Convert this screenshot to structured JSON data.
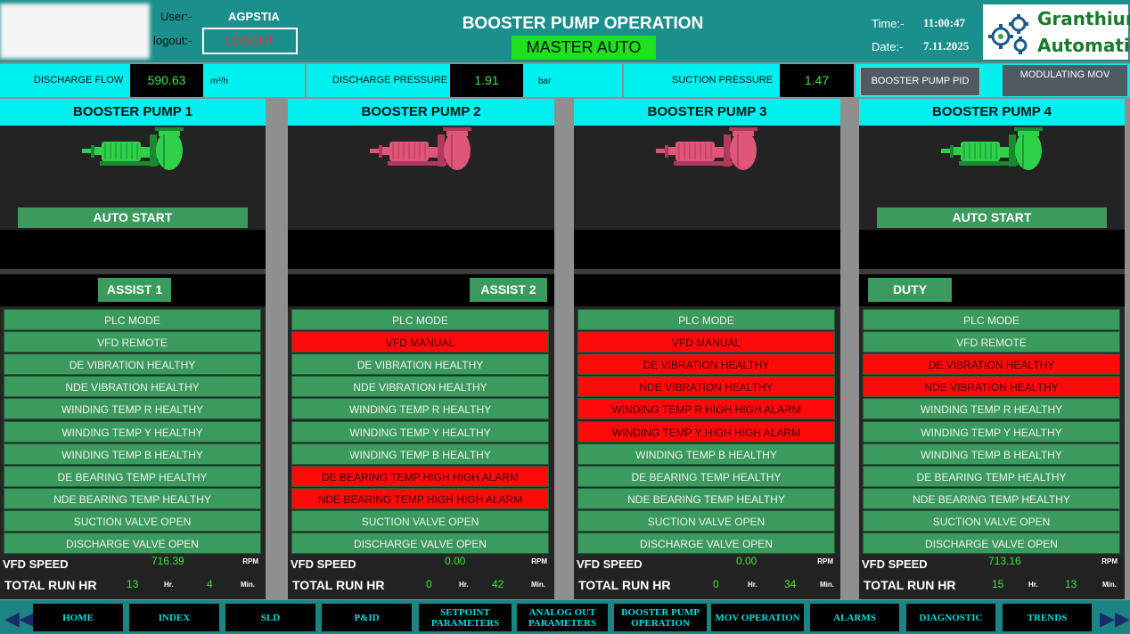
{
  "header": {
    "user_label": "User:-",
    "user_value": "AGPSTIA",
    "logout_label": "logout:-",
    "logout_button": "LOGOUT",
    "title": "BOOSTER PUMP OPERATION",
    "mode": "MASTER AUTO",
    "time_label": "Time:-",
    "time_value": "11:00:47",
    "date_label": "Date:-",
    "date_value": "7.11.2025",
    "logo_line1": "Granthium",
    "logo_line2": "Automation"
  },
  "measurements": {
    "discharge_flow_label": "DISCHARGE FLOW",
    "discharge_flow_value": "590.63",
    "discharge_flow_unit": "m³/h",
    "discharge_pressure_label": "DISCHARGE PRESSURE",
    "discharge_pressure_value": "1.91",
    "discharge_pressure_unit": "bar",
    "suction_pressure_label": "SUCTION PRESSURE",
    "suction_pressure_value": "1.47",
    "pid_button": "BOOSTER PUMP PID",
    "mov_button": "MODULATING MOV"
  },
  "labels": {
    "vfd_speed": "VFD SPEED",
    "rpm": "RPM",
    "total_run": "TOTAL RUN HR",
    "hr": "Hr.",
    "min": "Min."
  },
  "colors": {
    "ok": "#3b9a5e",
    "alarm": "#ff0a0a",
    "running": "#2fd14a",
    "stopped": "#e0557a"
  },
  "pumps": [
    {
      "title": "BOOSTER PUMP 1",
      "running": true,
      "auto_start": "AUTO START",
      "role": "ASSIST 1",
      "status": [
        {
          "text": "PLC MODE",
          "alarm": false
        },
        {
          "text": "VFD REMOTE",
          "alarm": false
        },
        {
          "text": "DE VIBRATION HEALTHY",
          "alarm": false
        },
        {
          "text": "NDE VIBRATION HEALTHY",
          "alarm": false
        },
        {
          "text": "WINDING TEMP R HEALTHY",
          "alarm": false
        },
        {
          "text": "WINDING TEMP Y HEALTHY",
          "alarm": false
        },
        {
          "text": "WINDING TEMP B HEALTHY",
          "alarm": false
        },
        {
          "text": "DE BEARING TEMP HEALTHY",
          "alarm": false
        },
        {
          "text": "NDE BEARING TEMP HEALTHY",
          "alarm": false
        },
        {
          "text": "SUCTION VALVE OPEN",
          "alarm": false
        },
        {
          "text": "DISCHARGE VALVE OPEN",
          "alarm": false
        }
      ],
      "vfd_speed": "716.39",
      "run_hr": "13",
      "run_min": "4"
    },
    {
      "title": "BOOSTER PUMP 2",
      "running": false,
      "auto_start": "",
      "role": "ASSIST 2",
      "status": [
        {
          "text": "PLC MODE",
          "alarm": false
        },
        {
          "text": "VFD MANUAL",
          "alarm": true
        },
        {
          "text": "DE VIBRATION HEALTHY",
          "alarm": false
        },
        {
          "text": "NDE VIBRATION HEALTHY",
          "alarm": false
        },
        {
          "text": "WINDING TEMP R HEALTHY",
          "alarm": false
        },
        {
          "text": "WINDING TEMP Y HEALTHY",
          "alarm": false
        },
        {
          "text": "WINDING TEMP B HEALTHY",
          "alarm": false
        },
        {
          "text": "DE BEARING TEMP HIGH HIGH ALARM",
          "alarm": true
        },
        {
          "text": "NDE BEARING TEMP HIGH HIGH ALARM",
          "alarm": true
        },
        {
          "text": "SUCTION VALVE OPEN",
          "alarm": false
        },
        {
          "text": "DISCHARGE VALVE OPEN",
          "alarm": false
        }
      ],
      "vfd_speed": "0.00",
      "run_hr": "0",
      "run_min": "42"
    },
    {
      "title": "BOOSTER PUMP 3",
      "running": false,
      "auto_start": "",
      "role": "",
      "status": [
        {
          "text": "PLC MODE",
          "alarm": false
        },
        {
          "text": "VFD MANUAL",
          "alarm": true
        },
        {
          "text": "DE VIBRATION HEALTHY",
          "alarm": true
        },
        {
          "text": "NDE VIBRATION HEALTHY",
          "alarm": true
        },
        {
          "text": "WINDING TEMP R HIGH HIGH ALARM",
          "alarm": true
        },
        {
          "text": "WINDING TEMP Y HIGH HIGH ALARM",
          "alarm": true
        },
        {
          "text": "WINDING TEMP B HEALTHY",
          "alarm": false
        },
        {
          "text": "DE BEARING TEMP HEALTHY",
          "alarm": false
        },
        {
          "text": "NDE BEARING TEMP HEALTHY",
          "alarm": false
        },
        {
          "text": "SUCTION VALVE OPEN",
          "alarm": false
        },
        {
          "text": "DISCHARGE VALVE OPEN",
          "alarm": false
        }
      ],
      "vfd_speed": "0.00",
      "run_hr": "0",
      "run_min": "34"
    },
    {
      "title": "BOOSTER PUMP 4",
      "running": true,
      "auto_start": "AUTO START",
      "role": "DUTY",
      "status": [
        {
          "text": "PLC MODE",
          "alarm": false
        },
        {
          "text": "VFD REMOTE",
          "alarm": false
        },
        {
          "text": "DE VIBRATION HEALTHY",
          "alarm": true
        },
        {
          "text": "NDE VIBRATION HEALTHY",
          "alarm": true
        },
        {
          "text": "WINDING TEMP R HEALTHY",
          "alarm": false
        },
        {
          "text": "WINDING TEMP Y HEALTHY",
          "alarm": false
        },
        {
          "text": "WINDING TEMP B HEALTHY",
          "alarm": false
        },
        {
          "text": "DE BEARING TEMP HEALTHY",
          "alarm": false
        },
        {
          "text": "NDE BEARING TEMP HEALTHY",
          "alarm": false
        },
        {
          "text": "SUCTION VALVE OPEN",
          "alarm": false
        },
        {
          "text": "DISCHARGE VALVE OPEN",
          "alarm": false
        }
      ],
      "vfd_speed": "713.16",
      "run_hr": "15",
      "run_min": "13"
    }
  ],
  "nav": {
    "prev_icon": "double-left-arrow-icon",
    "next_icon": "double-right-arrow-icon",
    "items": [
      "HOME",
      "INDEX",
      "SLD",
      "P&ID",
      "SETPOINT PARAMETERS",
      "ANALOG OUT PARAMETERS",
      "BOOSTER PUMP OPERATION",
      "MOV OPERATION",
      "ALARMS",
      "DIAGNOSTIC",
      "TRENDS"
    ]
  }
}
